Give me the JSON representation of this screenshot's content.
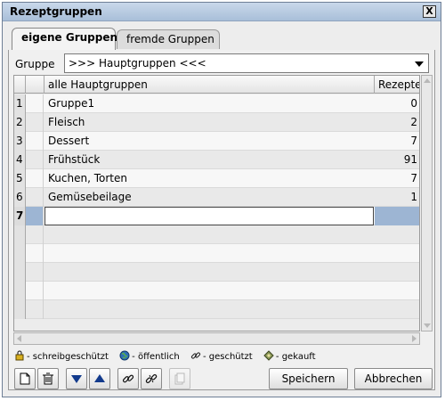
{
  "window": {
    "title": "Rezeptgruppen",
    "close_label": "X"
  },
  "tabs": [
    {
      "label": "eigene Gruppen",
      "active": true
    },
    {
      "label": "fremde Gruppen",
      "active": false
    }
  ],
  "gruppe": {
    "label": "Gruppe",
    "selected": ">>> Hauptgruppen <<<"
  },
  "table": {
    "columns": [
      "",
      "",
      "alle Hauptgruppen",
      "Rezepte"
    ],
    "rows": [
      {
        "num": "1",
        "name": "Gruppe1",
        "count": "0"
      },
      {
        "num": "2",
        "name": "Fleisch",
        "count": "2"
      },
      {
        "num": "3",
        "name": "Dessert",
        "count": "7"
      },
      {
        "num": "4",
        "name": "Frühstück",
        "count": "91"
      },
      {
        "num": "5",
        "name": "Kuchen, Torten",
        "count": "7"
      },
      {
        "num": "6",
        "name": "Gemüsebeilage",
        "count": "1"
      }
    ],
    "new_row": {
      "num": "7",
      "name": "",
      "count": ""
    }
  },
  "legend": [
    {
      "icon": "lock-icon",
      "label": "- schreibgeschützt"
    },
    {
      "icon": "globe-icon",
      "label": "- öffentlich"
    },
    {
      "icon": "chain-icon",
      "label": "- geschützt"
    },
    {
      "icon": "purchased-icon",
      "label": "- gekauft"
    }
  ],
  "buttons": {
    "save": "Speichern",
    "cancel": "Abbrechen"
  },
  "colors": {
    "accent": "#9db5d3",
    "title_bar": "#b8cbe3"
  }
}
